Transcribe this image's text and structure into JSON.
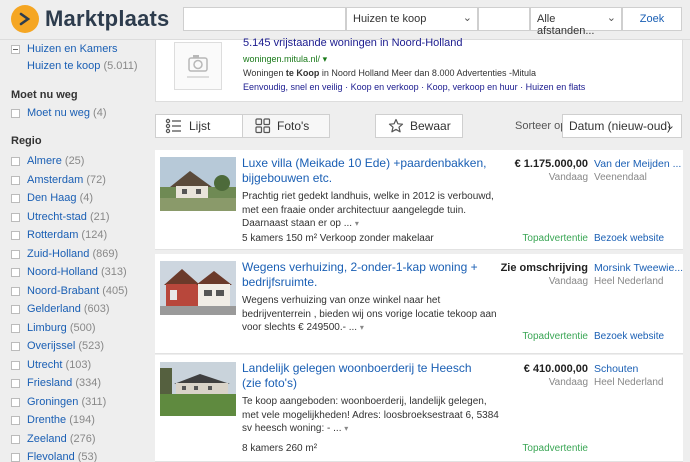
{
  "header": {
    "logo_text": "Marktplaats",
    "search_value": "",
    "category_select": "Huizen te koop",
    "postcode_value": "",
    "distance_select": "Alle afstanden...",
    "search_button": "Zoek"
  },
  "sidebar": {
    "category_parent": "Huizen en Kamers",
    "category_child": "Huizen te koop",
    "category_child_count": "(5.011)",
    "moet_heading": "Moet nu weg",
    "moet_item": "Moet nu weg",
    "moet_count": "(4)",
    "regio_heading": "Regio",
    "regions": [
      {
        "name": "Almere",
        "count": "(25)"
      },
      {
        "name": "Amsterdam",
        "count": "(72)"
      },
      {
        "name": "Den Haag",
        "count": "(4)"
      },
      {
        "name": "Utrecht-stad",
        "count": "(21)"
      },
      {
        "name": "Rotterdam",
        "count": "(124)"
      },
      {
        "name": "Zuid-Holland",
        "count": "(869)"
      },
      {
        "name": "Noord-Holland",
        "count": "(313)"
      },
      {
        "name": "Noord-Brabant",
        "count": "(405)"
      },
      {
        "name": "Gelderland",
        "count": "(603)"
      },
      {
        "name": "Limburg",
        "count": "(500)"
      },
      {
        "name": "Overijssel",
        "count": "(523)"
      },
      {
        "name": "Utrecht",
        "count": "(103)"
      },
      {
        "name": "Friesland",
        "count": "(334)"
      },
      {
        "name": "Groningen",
        "count": "(311)"
      },
      {
        "name": "Drenthe",
        "count": "(194)"
      },
      {
        "name": "Zeeland",
        "count": "(276)"
      },
      {
        "name": "Flevoland",
        "count": "(53)"
      }
    ]
  },
  "ad": {
    "title": "5.145 vrijstaande woningen in Noord-Holland",
    "url": "woningen.mitula.nl/",
    "desc_pre": "Woningen ",
    "desc_bold": "te Koop",
    "desc_post": " in Noord Holland Meer dan 8.000 Advertenties -Mitula",
    "links": "Eenvoudig, snel en veilig · Koop en verkoop · Koop, verkoop en huur · Huizen en flats"
  },
  "toolbar": {
    "list_label": "Lijst",
    "photo_label": "Foto's",
    "save_label": "Bewaar",
    "sort_label": "Sorteer op",
    "sort_value": "Datum (nieuw-oud)"
  },
  "listings": [
    {
      "title": "Luxe villa (Meikade 10 Ede) +paardenbakken, bijgebouwen etc.",
      "desc": "Prachtig riet gedekt landhuis, welke in 2012 is verbouwd, met een fraaie onder architectuur aangelegde tuin. Daarnaast staan er op ...",
      "meta": "5 kamers     150 m² Verkoop zonder makelaar",
      "price": "€ 1.175.000,00",
      "date": "Vandaag",
      "seller": "Van der Meijden ...",
      "location": "Veenendaal",
      "badge": "Topadvertentie",
      "visit": "Bezoek website"
    },
    {
      "title": "Wegens verhuizing, 2-onder-1-kap woning + bedrijfsruimte.",
      "desc": "Wegens verhuizing van onze winkel naar het bedrijventerrein , bieden wij ons vorige locatie tekoop aan voor slechts € 249500.- ...",
      "meta": "",
      "price": "Zie omschrijving",
      "date": "Vandaag",
      "seller": "Morsink Tweewie...",
      "location": "Heel Nederland",
      "badge": "Topadvertentie",
      "visit": "Bezoek website"
    },
    {
      "title": "Landelijk gelegen woonboerderij te Heesch (zie foto's)",
      "desc": "Te koop aangeboden: woonboerderij, landelijk gelegen, met vele mogelijkheden! Adres: loosbroeksestraat 6, 5384 sv heesch woning: - ...",
      "meta": "8 kamers     260 m²",
      "price": "€ 410.000,00",
      "date": "Vandaag",
      "seller": "Schouten",
      "location": "Heel Nederland",
      "badge": "Topadvertentie",
      "visit": ""
    }
  ]
}
